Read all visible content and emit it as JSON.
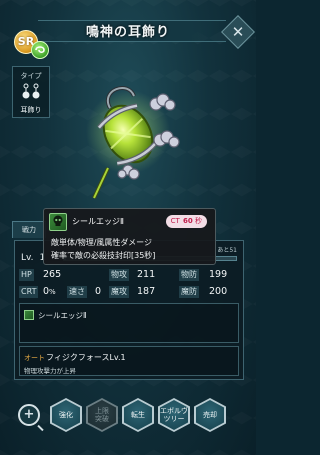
{
  "header": {
    "title": "鳴神の耳飾り",
    "rarity": "SR",
    "close_label": "✕"
  },
  "type_panel": {
    "label": "タイプ",
    "icon": "ｺﾞｺﾞ",
    "name": "耳飾り"
  },
  "skill_popup": {
    "name": "シールエッジⅡ",
    "ct_label": "CT",
    "ct_value": "60",
    "ct_unit": "秒",
    "desc_line1": "敵単体/物理/風属性ダメージ",
    "desc_line2": "確率で敵の必殺技封印[35秒]"
  },
  "stats": {
    "power_tab": "戦力",
    "level_label": "Lv.",
    "level": "1",
    "level_right": "あと51",
    "level_progress": 0.01,
    "rows": [
      [
        {
          "tag": "HP",
          "value": "265"
        },
        {
          "tag": "物攻",
          "value": "211"
        },
        {
          "tag": "物防",
          "value": "199"
        }
      ],
      [
        {
          "tag": "CRT",
          "value": "0",
          "unit": "%"
        },
        {
          "tag": "速さ",
          "value": "0"
        },
        {
          "tag": "魔攻",
          "value": "187"
        },
        {
          "tag": "魔防",
          "value": "200"
        }
      ]
    ]
  },
  "skill_slot": {
    "name": "シールエッジⅡ"
  },
  "auto": {
    "tag": "オート",
    "name": "フィジクフォースLv.1",
    "desc": "物理攻撃力が上昇"
  },
  "buttons": {
    "enhance": "強化",
    "limit_break_1": "上限",
    "limit_break_2": "突破",
    "reincarnate": "転生",
    "evolve_1": "エボルヴ",
    "evolve_2": "ツリー",
    "sell": "売却"
  },
  "colors": {
    "background": "#0c2630",
    "accent": "#b7e23a",
    "ct_text": "#c01e4c"
  }
}
